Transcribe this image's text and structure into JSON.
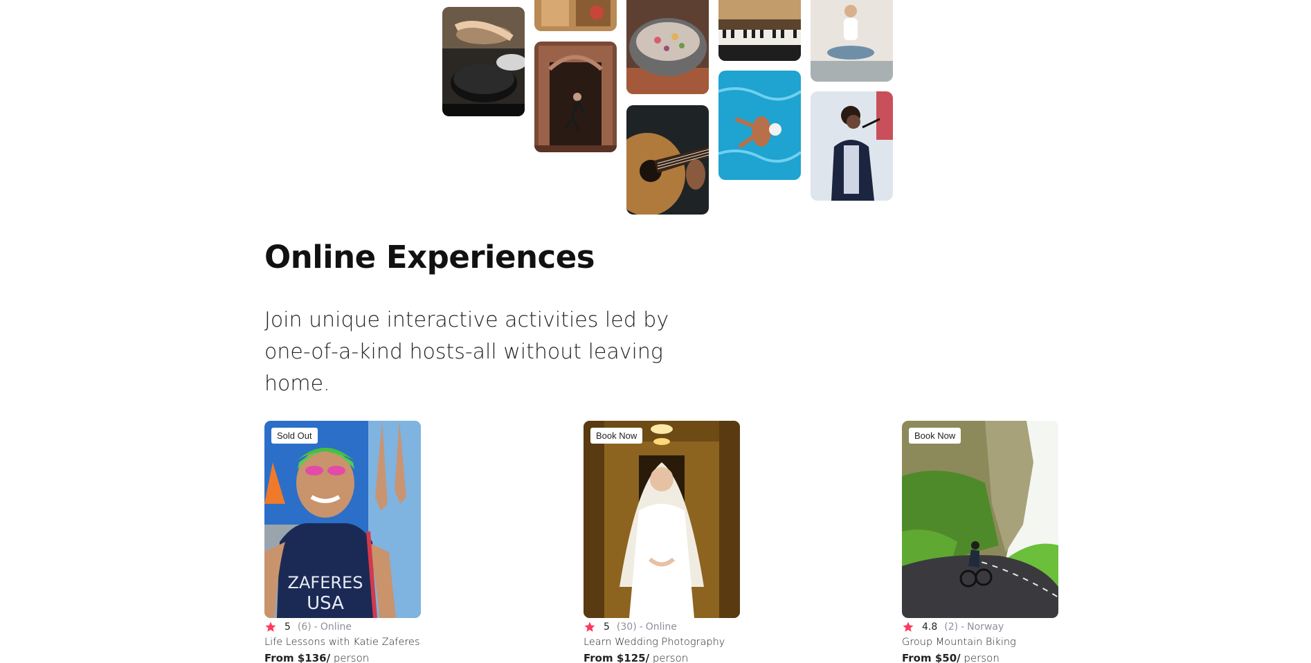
{
  "hero": {
    "photos": [
      {
        "name": "cooking-photo"
      },
      {
        "name": "market-photo"
      },
      {
        "name": "dancer-doorway-photo"
      },
      {
        "name": "food-bowl-photo"
      },
      {
        "name": "guitar-photo"
      },
      {
        "name": "piano-photo"
      },
      {
        "name": "swimmer-photo"
      },
      {
        "name": "yoga-photo"
      },
      {
        "name": "singer-photo"
      }
    ]
  },
  "section": {
    "title": "Online Experiences",
    "description": "Join unique interactive activities led by one-of-a-kind hosts-all without leaving home."
  },
  "cards": [
    {
      "badge": "Sold Out",
      "rating": "5",
      "count": "(6)",
      "separator": "-",
      "location": "Online",
      "title": "Life Lessons with Katie Zaferes",
      "price": "From $136/",
      "unit": "person",
      "image_text_1": "ZAFERES",
      "image_text_2": "USA"
    },
    {
      "badge": "Book Now",
      "rating": "5",
      "count": "(30)",
      "separator": "-",
      "location": "Online",
      "title": "Learn Wedding Photography",
      "price": "From $125/",
      "unit": "person"
    },
    {
      "badge": "Book Now",
      "rating": "4.8",
      "count": "(2)",
      "separator": "-",
      "location": "Norway",
      "title": "Group Mountain Biking",
      "price": "From $50/",
      "unit": "person"
    }
  ],
  "colors": {
    "star": "#fe395c",
    "muted_text": "#918e9b",
    "primary_text": "#222222"
  },
  "icons": {
    "star": "star-icon"
  }
}
